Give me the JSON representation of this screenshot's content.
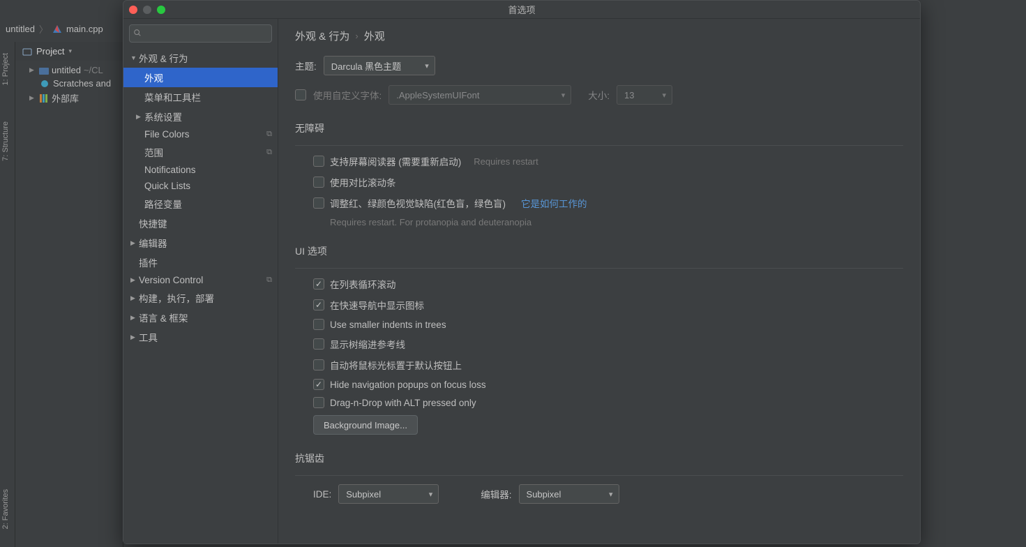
{
  "ide": {
    "breadcrumb_project": "untitled",
    "breadcrumb_file": "main.cpp",
    "left_tabs": {
      "project": "1: Project",
      "structure": "7: Structure",
      "favorites": "2: Favorites"
    },
    "project_panel_title": "Project",
    "tree": {
      "root": "untitled",
      "root_hint": "~/CL",
      "scratches": "Scratches and",
      "external": "外部库"
    }
  },
  "dialog": {
    "title": "首选项",
    "search_placeholder": "",
    "breadcrumb_parent": "外观 & 行为",
    "breadcrumb_current": "外观",
    "categories": {
      "appearance_behavior": "外观 & 行为",
      "appearance": "外观",
      "menus_toolbars": "菜单和工具栏",
      "system_settings": "系统设置",
      "file_colors": "File Colors",
      "scopes": "范围",
      "notifications": "Notifications",
      "quick_lists": "Quick Lists",
      "path_variables": "路径变量",
      "keymap": "快捷键",
      "editor": "编辑器",
      "plugins": "插件",
      "version_control": "Version Control",
      "build": "构建，执行，部署",
      "lang": "语言 & 框架",
      "tools": "工具"
    },
    "theme_label": "主题:",
    "theme_value": "Darcula 黑色主题",
    "custom_font_label": "使用自定义字体:",
    "font_value": ".AppleSystemUIFont",
    "size_label": "大小:",
    "size_value": "13",
    "accessibility_title": "无障碍",
    "acc_screen_reader": "支持屏幕阅读器 (需要重新启动)",
    "acc_screen_reader_hint": "Requires restart",
    "acc_contrast": "使用对比滚动条",
    "acc_color_def": "调整红、绿颜色视觉缺陷(红色盲，绿色盲)",
    "acc_color_link": "它是如何工作的",
    "acc_color_hint": "Requires restart. For protanopia and deuteranopia",
    "ui_options_title": "UI 选项",
    "ui_cyclic": "在列表循环滚动",
    "ui_quick_icons": "在快速导航中显示图标",
    "ui_smaller_indents": "Use smaller indents in trees",
    "ui_tree_guides": "显示树缩进参考线",
    "ui_mouse_default": "自动将鼠标光标置于默认按钮上",
    "ui_hide_nav": "Hide navigation popups on focus loss",
    "ui_dnd_alt": "Drag-n-Drop with ALT pressed only",
    "bg_image_btn": "Background Image...",
    "antialias_title": "抗锯齿",
    "aa_ide_label": "IDE:",
    "aa_ide_value": "Subpixel",
    "aa_editor_label": "编辑器:",
    "aa_editor_value": "Subpixel"
  }
}
